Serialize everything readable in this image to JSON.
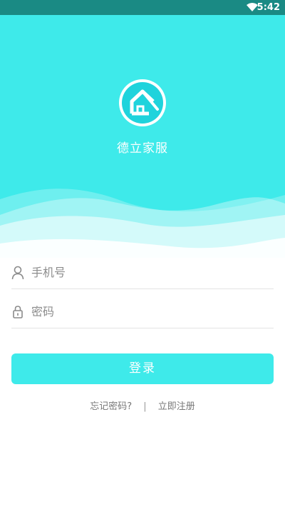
{
  "status_bar": {
    "time": "5:42",
    "wifi_icon": "wifi-icon"
  },
  "app": {
    "name": "德立家服",
    "logo_icon": "house-logo-icon",
    "brand_color": "#3eeaea"
  },
  "form": {
    "phone": {
      "placeholder": "手机号",
      "icon": "user-icon"
    },
    "password": {
      "placeholder": "密码",
      "icon": "lock-icon"
    }
  },
  "login_button": {
    "label": "登录"
  },
  "links": {
    "forgot": "忘记密码?",
    "separator": "|",
    "register": "立即注册"
  }
}
